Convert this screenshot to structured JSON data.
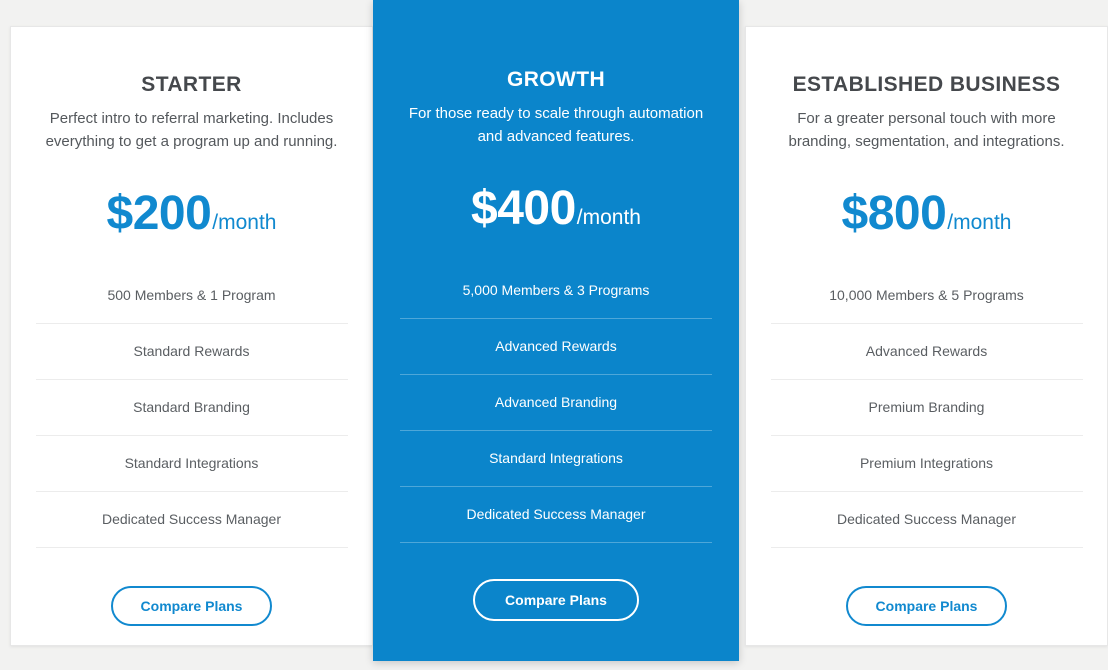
{
  "theme": {
    "page_background": "#f2f2f1",
    "accent_blue": "#1189cf",
    "featured_background": "#0b85cb",
    "title_color": "#45484c",
    "body_text_color": "#54585c"
  },
  "plans": [
    {
      "name": "STARTER",
      "description": "Perfect intro to referral marketing. Includes everything to get a program up and running.",
      "price_amount": "$200",
      "price_period": "/month",
      "features": [
        "500 Members & 1 Program",
        "Standard Rewards",
        "Standard Branding",
        "Standard Integrations",
        "Dedicated Success Manager"
      ],
      "cta_label": "Compare Plans",
      "featured": false
    },
    {
      "name": "GROWTH",
      "description": "For those ready to scale through automation and advanced features.",
      "price_amount": "$400",
      "price_period": "/month",
      "features": [
        "5,000 Members & 3 Programs",
        "Advanced Rewards",
        "Advanced Branding",
        "Standard Integrations",
        "Dedicated Success Manager"
      ],
      "cta_label": "Compare Plans",
      "featured": true
    },
    {
      "name": "ESTABLISHED BUSINESS",
      "description": "For a greater personal touch with more branding, segmentation, and integrations.",
      "price_amount": "$800",
      "price_period": "/month",
      "features": [
        "10,000 Members & 5 Programs",
        "Advanced Rewards",
        "Premium Branding",
        "Premium Integrations",
        "Dedicated Success Manager"
      ],
      "cta_label": "Compare Plans",
      "featured": false
    }
  ]
}
